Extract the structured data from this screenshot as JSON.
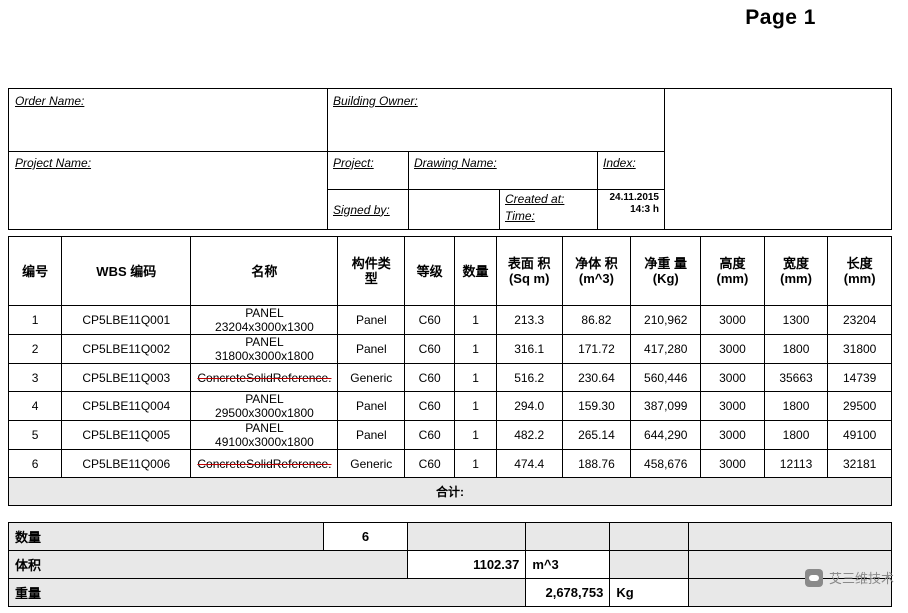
{
  "page_title": "Page 1",
  "header": {
    "order_name_label": "Order Name:",
    "building_owner_label": "Building Owner:",
    "project_name_label": "Project Name:",
    "project_label": "Project:",
    "drawing_name_label": "Drawing Name:",
    "index_label": "Index:",
    "signed_by_label": "Signed by:",
    "created_at_label": "Created at:",
    "time_label": "Time:",
    "created_date": "24.11.2015",
    "created_time": "14:3 h"
  },
  "table": {
    "columns": [
      "编号",
      "WBS 编码",
      "名称",
      "构件类型",
      "等级",
      "数量",
      "表面 积\n(Sq m)",
      "净体 积\n(m^3)",
      "净重 量\n(Kg)",
      "高度\n(mm)",
      "宽度\n(mm)",
      "长度\n(mm)"
    ],
    "columns_parts": [
      {
        "l1": "编号",
        "l2": ""
      },
      {
        "l1": "WBS 编码",
        "l2": ""
      },
      {
        "l1": "名称",
        "l2": ""
      },
      {
        "l1": "构件类",
        "l2": "型"
      },
      {
        "l1": "等级",
        "l2": ""
      },
      {
        "l1": "数量",
        "l2": ""
      },
      {
        "l1": "表面 积",
        "l2": "(Sq m)"
      },
      {
        "l1": "净体 积",
        "l2": "(m^3)"
      },
      {
        "l1": "净重 量",
        "l2": "(Kg)"
      },
      {
        "l1": "高度",
        "l2": "(mm)"
      },
      {
        "l1": "宽度",
        "l2": "(mm)"
      },
      {
        "l1": "长度",
        "l2": "(mm)"
      }
    ],
    "rows": [
      {
        "no": "1",
        "wbs": "CP5LBE11Q001",
        "name": "PANEL 23204x3000x1300",
        "strike": false,
        "type": "Panel",
        "grade": "C60",
        "qty": "1",
        "surface": "213.3",
        "volume": "86.82",
        "weight": "210,962",
        "height": "3000",
        "width": "1300",
        "length": "23204"
      },
      {
        "no": "2",
        "wbs": "CP5LBE11Q002",
        "name": "PANEL 31800x3000x1800",
        "strike": false,
        "type": "Panel",
        "grade": "C60",
        "qty": "1",
        "surface": "316.1",
        "volume": "171.72",
        "weight": "417,280",
        "height": "3000",
        "width": "1800",
        "length": "31800"
      },
      {
        "no": "3",
        "wbs": "CP5LBE11Q003",
        "name": "ConcreteSolidReference.",
        "strike": true,
        "type": "Generic",
        "grade": "C60",
        "qty": "1",
        "surface": "516.2",
        "volume": "230.64",
        "weight": "560,446",
        "height": "3000",
        "width": "35663",
        "length": "14739"
      },
      {
        "no": "4",
        "wbs": "CP5LBE11Q004",
        "name": "PANEL 29500x3000x1800",
        "strike": false,
        "type": "Panel",
        "grade": "C60",
        "qty": "1",
        "surface": "294.0",
        "volume": "159.30",
        "weight": "387,099",
        "height": "3000",
        "width": "1800",
        "length": "29500"
      },
      {
        "no": "5",
        "wbs": "CP5LBE11Q005",
        "name": "PANEL 49100x3000x1800",
        "strike": false,
        "type": "Panel",
        "grade": "C60",
        "qty": "1",
        "surface": "482.2",
        "volume": "265.14",
        "weight": "644,290",
        "height": "3000",
        "width": "1800",
        "length": "49100"
      },
      {
        "no": "6",
        "wbs": "CP5LBE11Q006",
        "name": "ConcreteSolidReference.",
        "strike": true,
        "type": "Generic",
        "grade": "C60",
        "qty": "1",
        "surface": "474.4",
        "volume": "188.76",
        "weight": "458,676",
        "height": "3000",
        "width": "12113",
        "length": "32181"
      }
    ],
    "total_label": "合计:"
  },
  "summary": {
    "rows": [
      {
        "label": "数量",
        "value": "6",
        "unit": ""
      },
      {
        "label": "体积",
        "value": "1102.37",
        "unit": "m^3"
      },
      {
        "label": "重量",
        "value": "2,678,753",
        "unit": "Kg"
      }
    ]
  },
  "watermark": {
    "text": "艾三维技术",
    "icon": "wechat-icon"
  }
}
